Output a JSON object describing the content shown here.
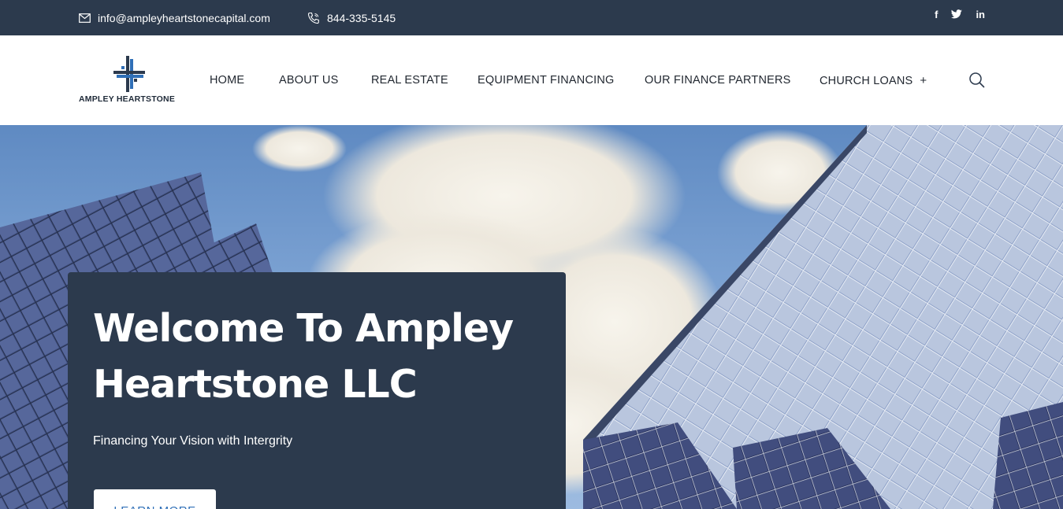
{
  "topbar": {
    "email": "info@ampleyheartstonecapital.com",
    "phone": "844-335-5145",
    "socials": [
      {
        "label": "f",
        "icon": "facebook-icon"
      },
      {
        "label": "𝕥",
        "icon": "twitter-icon"
      },
      {
        "label": "in",
        "icon": "linkedin-icon"
      }
    ]
  },
  "brand": {
    "name": "AMPLEY HEARTSTONE",
    "colors": {
      "dark_navy": "#2c3a4d",
      "accent_blue": "#2f6fb7"
    }
  },
  "nav": {
    "items": [
      "HOME",
      "ABOUT US",
      "REAL ESTATE",
      "EQUIPMENT FINANCING",
      "OUR FINANCE PARTNERS",
      "CHURCH LOANS"
    ],
    "dropdown_marker": "+"
  },
  "hero": {
    "title": "Welcome To Ampley Heartstone LLC",
    "subtitle": "Financing Your Vision with Intergrity",
    "cta_label": "LEARN MORE"
  }
}
